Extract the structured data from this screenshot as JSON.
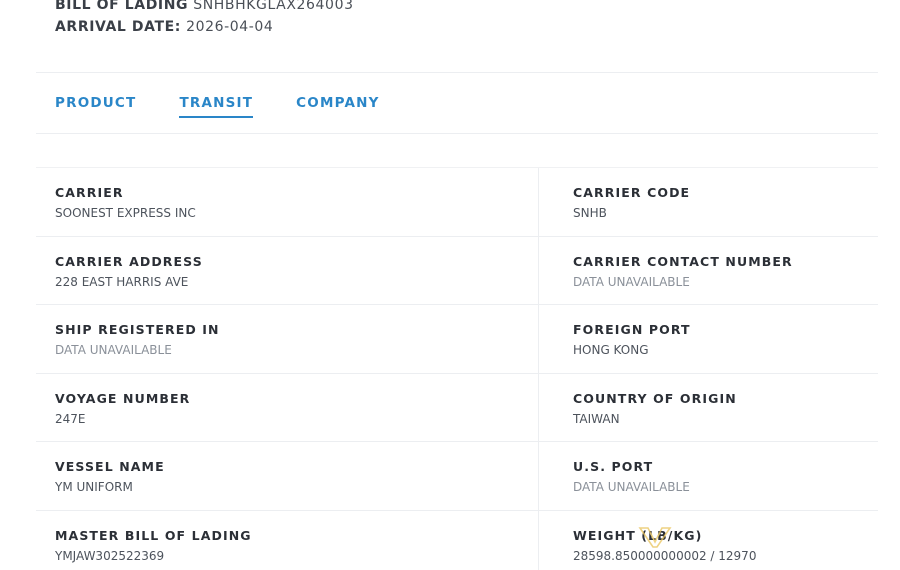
{
  "header": {
    "bill_of_lading_label": "BILL OF LADING",
    "bill_of_lading_value": "SNHBHKGLAX264003",
    "arrival_date_label": "ARRIVAL DATE:",
    "arrival_date_value": "2026-04-04"
  },
  "tabs": [
    {
      "label": "PRODUCT",
      "active": false
    },
    {
      "label": "TRANSIT",
      "active": true
    },
    {
      "label": "COMPANY",
      "active": false
    }
  ],
  "fields": {
    "carrier": {
      "label": "CARRIER",
      "value": "SOONEST EXPRESS INC"
    },
    "carrier_code": {
      "label": "CARRIER CODE",
      "value": "SNHB"
    },
    "carrier_address": {
      "label": "CARRIER ADDRESS",
      "value": "228 EAST HARRIS AVE"
    },
    "carrier_contact_number": {
      "label": "CARRIER CONTACT NUMBER",
      "value": "DATA UNAVAILABLE"
    },
    "ship_registered_in": {
      "label": "SHIP REGISTERED IN",
      "value": "DATA UNAVAILABLE"
    },
    "foreign_port": {
      "label": "FOREIGN PORT",
      "value": "HONG KONG"
    },
    "voyage_number": {
      "label": "VOYAGE NUMBER",
      "value": "247E"
    },
    "country_of_origin": {
      "label": "COUNTRY OF ORIGIN",
      "value": "TAIWAN"
    },
    "vessel_name": {
      "label": "VESSEL NAME",
      "value": "YM UNIFORM"
    },
    "us_port": {
      "label": "U.S. PORT",
      "value": "DATA UNAVAILABLE"
    },
    "master_bill_of_lading": {
      "label": "MASTER BILL OF LADING",
      "value": "YMJAW302522369"
    },
    "weight": {
      "label": "WEIGHT (LB/KG)",
      "value": "28598.850000000002 / 12970"
    }
  },
  "colors": {
    "accent": "#2a86c8",
    "muted_text": "#8a9099",
    "divider": "#eceef1"
  }
}
